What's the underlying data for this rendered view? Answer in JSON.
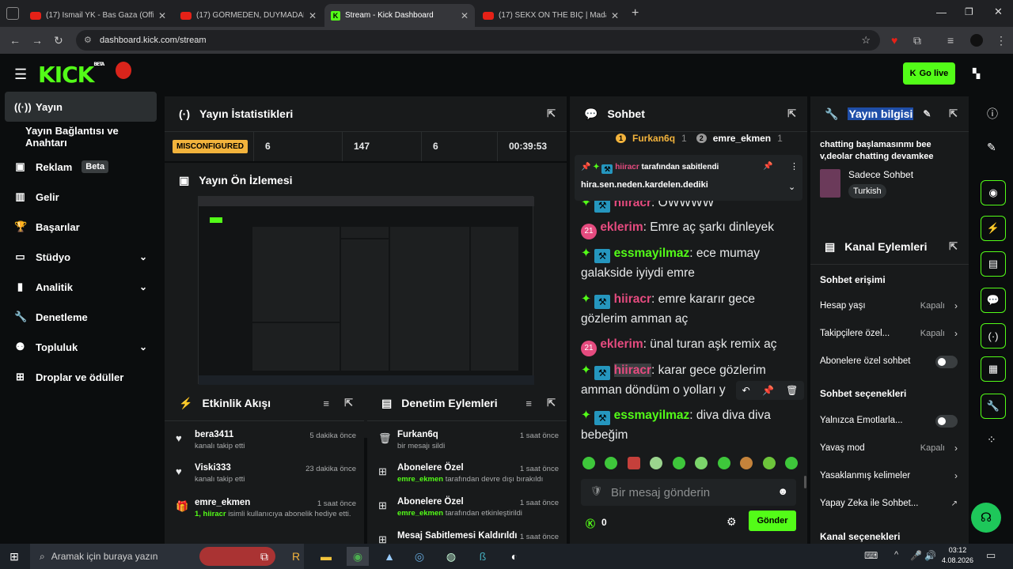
{
  "browser": {
    "tabs": [
      {
        "title": "(17) İsmail YK - Bas Gaza (Offici",
        "active": false
      },
      {
        "title": "(17) GÖRMEDEN, DUYMADAN",
        "active": false
      },
      {
        "title": "Stream - Kick Dashboard",
        "active": true
      },
      {
        "title": "(17) SEKX ON THE BİÇ | Madara",
        "active": false
      }
    ],
    "url": "dashboard.kick.com/stream"
  },
  "app": {
    "logo": "KICK",
    "logo_sup": "BETA",
    "go_live": "Go live"
  },
  "sidebar": {
    "items": [
      {
        "label": "Yayın",
        "icon": "broadcast-icon",
        "active": true
      },
      {
        "label": "Yayın Bağlantısı ve Anahtarı",
        "icon": "",
        "active": false
      },
      {
        "label": "Reklam",
        "icon": "ad-icon",
        "badge": "Beta"
      },
      {
        "label": "Gelir",
        "icon": "revenue-icon"
      },
      {
        "label": "Başarılar",
        "icon": "trophy-icon"
      },
      {
        "label": "Stüdyo",
        "icon": "studio-icon",
        "chevron": true
      },
      {
        "label": "Analitik",
        "icon": "chart-icon",
        "chevron": true
      },
      {
        "label": "Denetleme",
        "icon": "wrench-icon"
      },
      {
        "label": "Topluluk",
        "icon": "community-icon",
        "chevron": true
      },
      {
        "label": "Droplar ve ödüller",
        "icon": "gift-icon"
      }
    ]
  },
  "stats_panel": {
    "title": "Yayın İstatistikleri",
    "status": "MISCONFIGURED",
    "values": [
      "6",
      "147",
      "6",
      "00:39:53"
    ]
  },
  "preview": {
    "title": "Yayın Ön İzlemesi"
  },
  "activity": {
    "title": "Etkinlik Akışı",
    "items": [
      {
        "name": "bera3411",
        "sub": "kanalı takip etti",
        "time": "5 dakika önce"
      },
      {
        "name": "Viski333",
        "sub": "kanalı takip etti",
        "time": "23 dakika önce"
      },
      {
        "name": "emre_ekmen",
        "sub_user": "1, hiiracr",
        "sub": "isimli kullanıcıya abonelik hediye etti.",
        "time": "1 saat önce"
      }
    ]
  },
  "moderation": {
    "title": "Denetim Eylemleri",
    "items": [
      {
        "name": "Furkan6q",
        "sub": "bir mesajı sildi",
        "time": "1 saat önce"
      },
      {
        "name": "Abonelere Özel",
        "user": "emre_ekmen",
        "sub": "tarafından devre dışı bırakıldı",
        "time": "1 saat önce"
      },
      {
        "name": "Abonelere Özel",
        "user": "emre_ekmen",
        "sub": "tarafından etkinleştirildi",
        "time": "1 saat önce"
      },
      {
        "name": "Mesaj Sabitlemesi Kaldırıldı",
        "time": "1 saat önce"
      }
    ]
  },
  "chat": {
    "title": "Sohbet",
    "top_users": [
      {
        "name": "Furkan6q",
        "count": "1",
        "rank": "1"
      },
      {
        "name": "emre_ekmen",
        "count": "1",
        "rank": "2"
      }
    ],
    "pinned": {
      "by": "hiiracr",
      "by_suffix": "tarafından sabitlendi",
      "text": "hira.sen.neden.kardelen.dediki"
    },
    "messages": [
      {
        "user": "hiiracr",
        "text": "OWWWW",
        "color": "#e54b7f",
        "badges": "mod"
      },
      {
        "user": "eklerim",
        "text": "Emre aç şarkı dinleyek",
        "color": "#e54b7f",
        "badges": "gift",
        "gift": "21"
      },
      {
        "user": "essmayilmaz",
        "text": "ece mumay galakside iyiydi emre",
        "color": "#53fc18",
        "badges": "mod"
      },
      {
        "user": "hiiracr",
        "text": "emre kararır gece gözlerim amman aç",
        "color": "#e54b7f",
        "badges": "mod"
      },
      {
        "user": "eklerim",
        "text": "ünal turan aşk remix aç",
        "color": "#e54b7f",
        "badges": "gift",
        "gift": "21"
      },
      {
        "user": "hiiracr",
        "text": "karar gece gözlerim amman döndüm o yolları y",
        "color": "#e54b7f",
        "badges": "mod"
      },
      {
        "user": "essmayilmaz",
        "text": "diva diva diva bebeğim",
        "color": "#53fc18",
        "badges": "mod"
      }
    ],
    "input_placeholder": "Bir mesaj gönderin",
    "points": "0",
    "send": "Gönder"
  },
  "info": {
    "title": "Yayın bilgisi",
    "stream_title": "chatting başlamasınmı bee v,deolar chatting devamkee",
    "category": "Sadece Sohbet",
    "tag": "Turkish"
  },
  "channel_actions": {
    "title": "Kanal Eylemleri",
    "section1": "Sohbet erişimi",
    "rows1": [
      {
        "label": "Hesap yaşı",
        "value": "Kapalı",
        "type": "arrow"
      },
      {
        "label": "Takipçilere özel...",
        "value": "Kapalı",
        "type": "arrow"
      },
      {
        "label": "Abonelere özel sohbet",
        "type": "toggle"
      }
    ],
    "section2": "Sohbet seçenekleri",
    "rows2": [
      {
        "label": "Yalnızca Emotlarla...",
        "type": "toggle"
      },
      {
        "label": "Yavaş mod",
        "value": "Kapalı",
        "type": "arrow"
      },
      {
        "label": "Yasaklanmış kelimeler",
        "type": "arrow"
      },
      {
        "label": "Yapay Zeka ile Sohbet...",
        "type": "external"
      }
    ],
    "section3": "Kanal seçenekleri"
  },
  "taskbar": {
    "search": "Aramak için buraya yazın",
    "time": "03:12",
    "date": "4.08.2026"
  },
  "colors": {
    "accent": "#53fc18",
    "panel": "#181a1b",
    "bg": "#0b0d0e",
    "warning": "#f2b33c",
    "pink": "#e54b7f"
  }
}
